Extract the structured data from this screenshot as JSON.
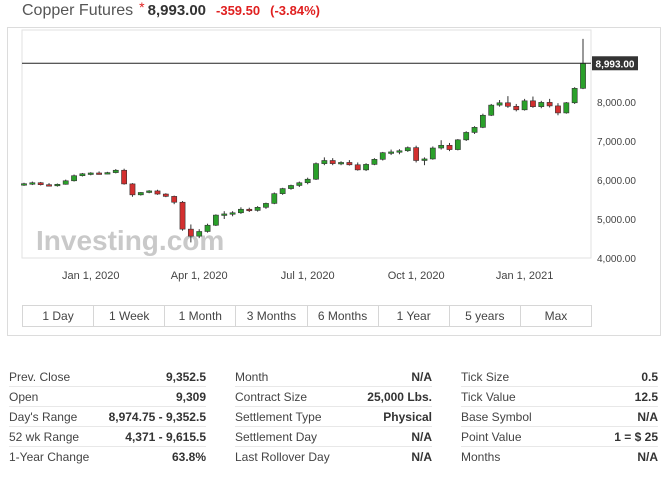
{
  "header": {
    "title": "Copper Futures",
    "star": "*",
    "price": "8,993.00",
    "change": "-359.50",
    "change_pct": "(-3.84%)"
  },
  "colors": {
    "up": "#2aa02a",
    "down": "#d32f2f",
    "negative_text": "#e02020"
  },
  "watermark": "Investing.com",
  "chart_data": {
    "type": "candlestick",
    "title": "",
    "xlabel": "",
    "ylabel": "",
    "ylim": [
      4000,
      10500
    ],
    "y_ticks": [
      "4,000.00",
      "5,000.00",
      "6,000.00",
      "7,000.00",
      "8,000.00"
    ],
    "y_tick_values": [
      4000,
      5000,
      6000,
      7000,
      8000
    ],
    "x_ticks": [
      "Jan 1, 2020",
      "Apr 1, 2020",
      "Jul 1, 2020",
      "Oct 1, 2020",
      "Jan 1, 2021"
    ],
    "x_tick_weeks": [
      8,
      21,
      34,
      47,
      60
    ],
    "last_price_label": "8,993.00",
    "last_price": 8993,
    "candles": [
      {
        "o": 5880,
        "h": 5930,
        "l": 5850,
        "c": 5905
      },
      {
        "o": 5905,
        "h": 5960,
        "l": 5870,
        "c": 5930
      },
      {
        "o": 5930,
        "h": 5950,
        "l": 5860,
        "c": 5880
      },
      {
        "o": 5880,
        "h": 5920,
        "l": 5840,
        "c": 5870
      },
      {
        "o": 5870,
        "h": 5910,
        "l": 5830,
        "c": 5890
      },
      {
        "o": 5890,
        "h": 6010,
        "l": 5880,
        "c": 5980
      },
      {
        "o": 5980,
        "h": 6140,
        "l": 5960,
        "c": 6110
      },
      {
        "o": 6110,
        "h": 6180,
        "l": 6090,
        "c": 6160
      },
      {
        "o": 6160,
        "h": 6200,
        "l": 6120,
        "c": 6180
      },
      {
        "o": 6180,
        "h": 6220,
        "l": 6140,
        "c": 6170
      },
      {
        "o": 6170,
        "h": 6210,
        "l": 6150,
        "c": 6190
      },
      {
        "o": 6190,
        "h": 6280,
        "l": 6170,
        "c": 6250
      },
      {
        "o": 6250,
        "h": 6290,
        "l": 5880,
        "c": 5900
      },
      {
        "o": 5900,
        "h": 5920,
        "l": 5570,
        "c": 5620
      },
      {
        "o": 5620,
        "h": 5690,
        "l": 5600,
        "c": 5680
      },
      {
        "o": 5680,
        "h": 5740,
        "l": 5660,
        "c": 5720
      },
      {
        "o": 5720,
        "h": 5750,
        "l": 5620,
        "c": 5640
      },
      {
        "o": 5640,
        "h": 5660,
        "l": 5560,
        "c": 5580
      },
      {
        "o": 5580,
        "h": 5600,
        "l": 5380,
        "c": 5430
      },
      {
        "o": 5430,
        "h": 5460,
        "l": 4700,
        "c": 4740
      },
      {
        "o": 4740,
        "h": 4860,
        "l": 4400,
        "c": 4560
      },
      {
        "o": 4560,
        "h": 4740,
        "l": 4510,
        "c": 4680
      },
      {
        "o": 4680,
        "h": 4880,
        "l": 4650,
        "c": 4840
      },
      {
        "o": 4840,
        "h": 5120,
        "l": 4820,
        "c": 5100
      },
      {
        "o": 5100,
        "h": 5200,
        "l": 5000,
        "c": 5130
      },
      {
        "o": 5130,
        "h": 5200,
        "l": 5070,
        "c": 5160
      },
      {
        "o": 5160,
        "h": 5300,
        "l": 5130,
        "c": 5250
      },
      {
        "o": 5250,
        "h": 5290,
        "l": 5180,
        "c": 5220
      },
      {
        "o": 5220,
        "h": 5330,
        "l": 5190,
        "c": 5300
      },
      {
        "o": 5300,
        "h": 5420,
        "l": 5260,
        "c": 5400
      },
      {
        "o": 5400,
        "h": 5680,
        "l": 5380,
        "c": 5650
      },
      {
        "o": 5650,
        "h": 5800,
        "l": 5620,
        "c": 5780
      },
      {
        "o": 5780,
        "h": 5880,
        "l": 5750,
        "c": 5860
      },
      {
        "o": 5860,
        "h": 5960,
        "l": 5820,
        "c": 5930
      },
      {
        "o": 5930,
        "h": 6060,
        "l": 5890,
        "c": 6020
      },
      {
        "o": 6020,
        "h": 6450,
        "l": 6000,
        "c": 6420
      },
      {
        "o": 6420,
        "h": 6580,
        "l": 6380,
        "c": 6500
      },
      {
        "o": 6500,
        "h": 6560,
        "l": 6380,
        "c": 6420
      },
      {
        "o": 6420,
        "h": 6480,
        "l": 6380,
        "c": 6450
      },
      {
        "o": 6450,
        "h": 6510,
        "l": 6370,
        "c": 6390
      },
      {
        "o": 6390,
        "h": 6450,
        "l": 6240,
        "c": 6260
      },
      {
        "o": 6260,
        "h": 6430,
        "l": 6230,
        "c": 6400
      },
      {
        "o": 6400,
        "h": 6560,
        "l": 6380,
        "c": 6530
      },
      {
        "o": 6530,
        "h": 6720,
        "l": 6500,
        "c": 6700
      },
      {
        "o": 6700,
        "h": 6780,
        "l": 6640,
        "c": 6720
      },
      {
        "o": 6720,
        "h": 6790,
        "l": 6660,
        "c": 6750
      },
      {
        "o": 6750,
        "h": 6860,
        "l": 6720,
        "c": 6830
      },
      {
        "o": 6830,
        "h": 6880,
        "l": 6450,
        "c": 6500
      },
      {
        "o": 6500,
        "h": 6580,
        "l": 6380,
        "c": 6540
      },
      {
        "o": 6540,
        "h": 6860,
        "l": 6520,
        "c": 6820
      },
      {
        "o": 6820,
        "h": 7020,
        "l": 6780,
        "c": 6890
      },
      {
        "o": 6890,
        "h": 6950,
        "l": 6740,
        "c": 6780
      },
      {
        "o": 6780,
        "h": 7050,
        "l": 6760,
        "c": 7030
      },
      {
        "o": 7030,
        "h": 7250,
        "l": 7000,
        "c": 7220
      },
      {
        "o": 7220,
        "h": 7380,
        "l": 7180,
        "c": 7350
      },
      {
        "o": 7350,
        "h": 7700,
        "l": 7330,
        "c": 7660
      },
      {
        "o": 7660,
        "h": 7950,
        "l": 7640,
        "c": 7920
      },
      {
        "o": 7920,
        "h": 8050,
        "l": 7880,
        "c": 7980
      },
      {
        "o": 7980,
        "h": 8150,
        "l": 7850,
        "c": 7890
      },
      {
        "o": 7890,
        "h": 7950,
        "l": 7760,
        "c": 7800
      },
      {
        "o": 7800,
        "h": 8080,
        "l": 7780,
        "c": 8030
      },
      {
        "o": 8030,
        "h": 8140,
        "l": 7850,
        "c": 7880
      },
      {
        "o": 7880,
        "h": 8030,
        "l": 7840,
        "c": 7990
      },
      {
        "o": 7990,
        "h": 8080,
        "l": 7860,
        "c": 7900
      },
      {
        "o": 7900,
        "h": 7970,
        "l": 7660,
        "c": 7720
      },
      {
        "o": 7720,
        "h": 8000,
        "l": 7700,
        "c": 7980
      },
      {
        "o": 7980,
        "h": 8380,
        "l": 7950,
        "c": 8350
      },
      {
        "o": 8350,
        "h": 9620,
        "l": 8330,
        "c": 8993
      }
    ]
  },
  "range_buttons": [
    "1 Day",
    "1 Week",
    "1 Month",
    "3 Months",
    "6 Months",
    "1 Year",
    "5 years",
    "Max"
  ],
  "stats": {
    "col1": [
      {
        "label": "Prev. Close",
        "value": "9,352.5"
      },
      {
        "label": "Open",
        "value": "9,309"
      },
      {
        "label": "Day's Range",
        "value": "8,974.75 - 9,352.5"
      },
      {
        "label": "52 wk Range",
        "value": "4,371 - 9,615.5"
      },
      {
        "label": "1-Year Change",
        "value": "63.8%"
      }
    ],
    "col2": [
      {
        "label": "Month",
        "value": "N/A"
      },
      {
        "label": "Contract Size",
        "value": "25,000 Lbs."
      },
      {
        "label": "Settlement Type",
        "value": "Physical"
      },
      {
        "label": "Settlement Day",
        "value": "N/A"
      },
      {
        "label": "Last Rollover Day",
        "value": "N/A"
      }
    ],
    "col3": [
      {
        "label": "Tick Size",
        "value": "0.5"
      },
      {
        "label": "Tick Value",
        "value": "12.5"
      },
      {
        "label": "Base Symbol",
        "value": "N/A"
      },
      {
        "label": "Point Value",
        "value": "1 = $ 25"
      },
      {
        "label": "Months",
        "value": "N/A"
      }
    ]
  }
}
